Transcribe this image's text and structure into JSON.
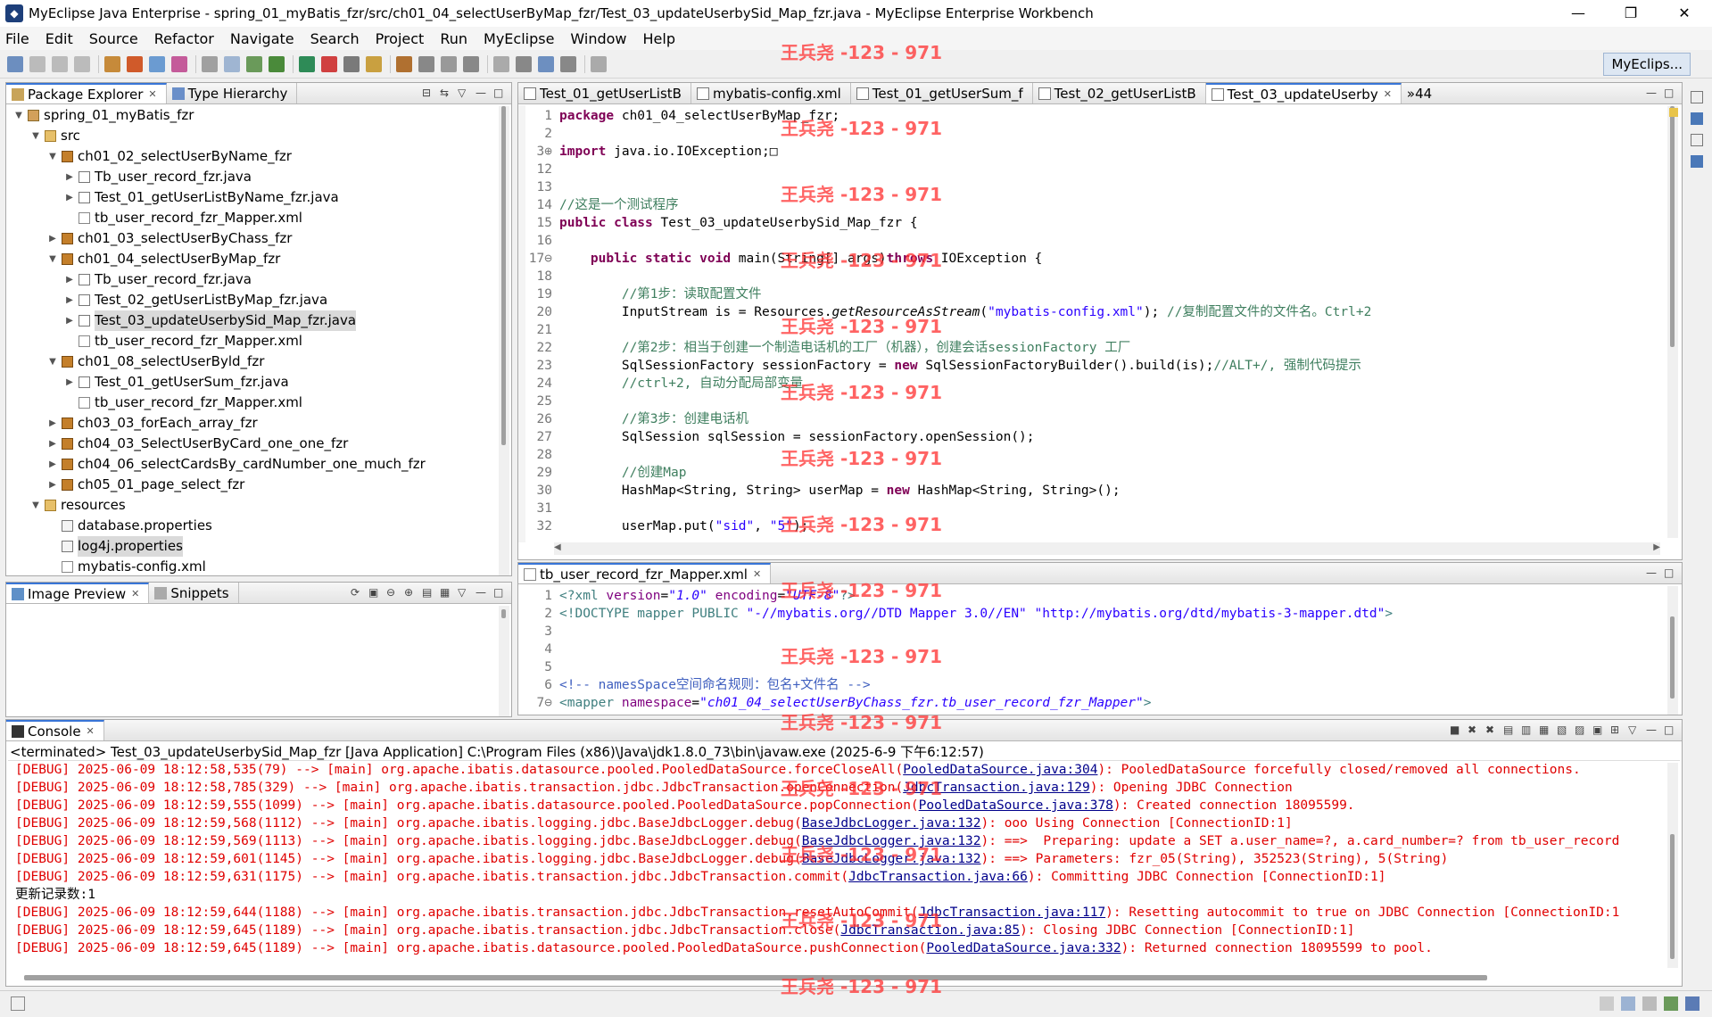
{
  "window": {
    "title": "MyEclipse Java Enterprise - spring_01_myBatis_fzr/src/ch01_04_selectUserByMap_fzr/Test_03_updateUserbySid_Map_fzr.java - MyEclipse Enterprise Workbench",
    "app_icon": "myeclipse-icon",
    "minimize": "—",
    "maximize": "❐",
    "close": "✕"
  },
  "menu": [
    "File",
    "Edit",
    "Source",
    "Refactor",
    "Navigate",
    "Search",
    "Project",
    "Run",
    "MyEclipse",
    "Window",
    "Help"
  ],
  "perspective": "MyEclips...",
  "watermark": "王兵尧 -123 - 971",
  "package_explorer": {
    "tabs": [
      "Package Explorer",
      "Type Hierarchy"
    ],
    "tree": [
      {
        "label": "spring_01_myBatis_fzr",
        "depth": 0,
        "icon": "project",
        "expanded": true
      },
      {
        "label": "src",
        "depth": 1,
        "icon": "src-folder",
        "expanded": true
      },
      {
        "label": "ch01_02_selectUserByName_fzr",
        "depth": 2,
        "icon": "package",
        "expanded": true
      },
      {
        "label": "Tb_user_record_fzr.java",
        "depth": 3,
        "icon": "java",
        "expanded": false
      },
      {
        "label": "Test_01_getUserListByName_fzr.java",
        "depth": 3,
        "icon": "java",
        "expanded": false
      },
      {
        "label": "tb_user_record_fzr_Mapper.xml",
        "depth": 3,
        "icon": "xml"
      },
      {
        "label": "ch01_03_selectUserByChass_fzr",
        "depth": 2,
        "icon": "package",
        "expanded": false
      },
      {
        "label": "ch01_04_selectUserByMap_fzr",
        "depth": 2,
        "icon": "package",
        "expanded": true
      },
      {
        "label": "Tb_user_record_fzr.java",
        "depth": 3,
        "icon": "java",
        "expanded": false
      },
      {
        "label": "Test_02_getUserListByMap_fzr.java",
        "depth": 3,
        "icon": "java",
        "expanded": false
      },
      {
        "label": "Test_03_updateUserbySid_Map_fzr.java",
        "depth": 3,
        "icon": "java",
        "expanded": false,
        "selected": true
      },
      {
        "label": "tb_user_record_fzr_Mapper.xml",
        "depth": 3,
        "icon": "xml"
      },
      {
        "label": "ch01_08_selectUserByld_fzr",
        "depth": 2,
        "icon": "package",
        "expanded": true
      },
      {
        "label": "Test_01_getUserSum_fzr.java",
        "depth": 3,
        "icon": "java",
        "expanded": false
      },
      {
        "label": "tb_user_record_fzr_Mapper.xml",
        "depth": 3,
        "icon": "xml"
      },
      {
        "label": "ch03_03_forEach_array_fzr",
        "depth": 2,
        "icon": "package",
        "expanded": false
      },
      {
        "label": "ch04_03_SelectUserByCard_one_one_fzr",
        "depth": 2,
        "icon": "package",
        "expanded": false
      },
      {
        "label": "ch04_06_selectCardsBy_cardNumber_one_much_fzr",
        "depth": 2,
        "icon": "package",
        "expanded": false
      },
      {
        "label": "ch05_01_page_select_fzr",
        "depth": 2,
        "icon": "package",
        "expanded": false
      },
      {
        "label": "resources",
        "depth": 1,
        "icon": "src-folder",
        "expanded": true
      },
      {
        "label": "database.properties",
        "depth": 2,
        "icon": "properties"
      },
      {
        "label": "log4j.properties",
        "depth": 2,
        "icon": "properties",
        "selected": true
      },
      {
        "label": "mybatis-config.xml",
        "depth": 2,
        "icon": "xml"
      }
    ]
  },
  "image_preview": {
    "tabs": [
      "Image Preview",
      "Snippets"
    ]
  },
  "editor": {
    "tabs": [
      "Test_01_getUserListB",
      "mybatis-config.xml",
      "Test_01_getUserSum_f",
      "Test_02_getUserListB",
      "Test_03_updateUserby"
    ],
    "overflow": "»44",
    "lines": [
      {
        "n": "1",
        "segs": [
          [
            "kw",
            "package"
          ],
          [
            "",
            "ch01_04_selectUserByMap_fzr;"
          ]
        ]
      },
      {
        "n": "2",
        "segs": []
      },
      {
        "n": "3⊕",
        "segs": [
          [
            "kw",
            "import"
          ],
          [
            "",
            "java.io.IOException;□"
          ]
        ]
      },
      {
        "n": "12",
        "segs": []
      },
      {
        "n": "13",
        "segs": []
      },
      {
        "n": "14",
        "segs": [
          [
            "cm",
            "//这是一个测试程序"
          ]
        ]
      },
      {
        "n": "15",
        "segs": [
          [
            "kw",
            "public class"
          ],
          [
            "",
            "Test_03_updateUserbySid_Map_fzr {"
          ]
        ]
      },
      {
        "n": "16",
        "segs": []
      },
      {
        "n": "17⊖",
        "segs": [
          [
            "",
            "    "
          ],
          [
            "kw",
            "public static void"
          ],
          [
            "",
            "main(String[] args)"
          ],
          [
            "kw",
            "throws"
          ],
          [
            "",
            "IOException {"
          ]
        ]
      },
      {
        "n": "18",
        "segs": []
      },
      {
        "n": "19",
        "segs": [
          [
            "",
            "        "
          ],
          [
            "cm",
            "//第1步：读取配置文件"
          ]
        ]
      },
      {
        "n": "20",
        "segs": [
          [
            "",
            "        InputStream is = Resources."
          ],
          [
            "it",
            "getResourceAsStream"
          ],
          [
            "",
            "("
          ],
          [
            "st",
            "\"mybatis-config.xml\""
          ],
          [
            "",
            "); "
          ],
          [
            "cm",
            "//复制配置文件的文件名。Ctrl+2"
          ]
        ]
      },
      {
        "n": "21",
        "segs": []
      },
      {
        "n": "22",
        "segs": [
          [
            "",
            "        "
          ],
          [
            "cm",
            "//第2步：相当于创建一个制造电话机的工厂（机器），创建会话sessionFactory 工厂"
          ]
        ]
      },
      {
        "n": "23",
        "segs": [
          [
            "",
            "        SqlSessionFactory sessionFactory = "
          ],
          [
            "kw",
            "new"
          ],
          [
            "",
            "SqlSessionFactoryBuilder().build(is);"
          ],
          [
            "cm",
            "//ALT+/, 强制代码提示"
          ]
        ]
      },
      {
        "n": "24",
        "segs": [
          [
            "",
            "        "
          ],
          [
            "cm",
            "//ctrl+2, 自动分配局部变量"
          ]
        ]
      },
      {
        "n": "25",
        "segs": []
      },
      {
        "n": "26",
        "segs": [
          [
            "",
            "        "
          ],
          [
            "cm",
            "//第3步：创建电话机"
          ]
        ]
      },
      {
        "n": "27",
        "segs": [
          [
            "",
            "        SqlSession sqlSession = sessionFactory.openSession();"
          ]
        ]
      },
      {
        "n": "28",
        "segs": []
      },
      {
        "n": "29",
        "segs": [
          [
            "",
            "        "
          ],
          [
            "cm",
            "//创建Map"
          ]
        ]
      },
      {
        "n": "30",
        "segs": [
          [
            "",
            "        HashMap<String, String> userMap = "
          ],
          [
            "kw",
            "new"
          ],
          [
            "",
            "HashMap<String, String>();"
          ]
        ]
      },
      {
        "n": "31",
        "segs": []
      },
      {
        "n": "32",
        "segs": [
          [
            "",
            "        userMap.put("
          ],
          [
            "st",
            "\"sid\""
          ],
          [
            "",
            ", "
          ],
          [
            "st",
            "\"5\""
          ],
          [
            "",
            ");"
          ]
        ]
      }
    ]
  },
  "xml_editor": {
    "tab": "tb_user_record_fzr_Mapper.xml",
    "lines": [
      {
        "n": "1",
        "segs": [
          [
            "xtag",
            "<?xml "
          ],
          [
            "xattr",
            "version"
          ],
          [
            "",
            "="
          ],
          [
            "xval",
            "\"1.0\""
          ],
          [
            "xattr",
            " encoding"
          ],
          [
            "",
            "="
          ],
          [
            "xval",
            "\"UTF-8\""
          ],
          [
            "xtag",
            "?>"
          ]
        ]
      },
      {
        "n": "2",
        "segs": [
          [
            "xtag",
            "<!DOCTYPE mapper PUBLIC "
          ],
          [
            "st",
            "\"-//mybatis.org//DTD Mapper 3.0//EN\""
          ],
          [
            "",
            " "
          ],
          [
            "st",
            "\"http://mybatis.org/dtd/mybatis-3-mapper.dtd\""
          ],
          [
            "xtag",
            ">"
          ]
        ]
      },
      {
        "n": "3",
        "segs": []
      },
      {
        "n": "4",
        "segs": []
      },
      {
        "n": "5",
        "segs": []
      },
      {
        "n": "6",
        "segs": [
          [
            "xcm",
            "<!-- namesSpace空间命名规则：包名+文件名 -->"
          ]
        ]
      },
      {
        "n": "7⊖",
        "segs": [
          [
            "xtag",
            "<mapper "
          ],
          [
            "xattr",
            "namespace"
          ],
          [
            "",
            "="
          ],
          [
            "xval",
            "\"ch01_04_selectUserByChass_fzr.tb_user_record_fzr_Mapper\""
          ],
          [
            "xtag",
            ">"
          ]
        ]
      }
    ]
  },
  "console": {
    "tab": "Console",
    "header": "<terminated> Test_03_updateUserbySid_Map_fzr [Java Application] C:\\Program Files (x86)\\Java\\jdk1.8.0_73\\bin\\javaw.exe (2025-6-9 下午6:12:57)",
    "lines": [
      {
        "type": "debug",
        "pre": "[DEBUG] 2025-06-09 18:12:58,535(79) --> [main] org.apache.ibatis.datasource.pooled.PooledDataSource.forceCloseAll(",
        "link": "PooledDataSource.java:304",
        "post": "): PooledDataSource forcefully closed/removed all connections."
      },
      {
        "type": "debug",
        "pre": "[DEBUG] 2025-06-09 18:12:58,785(329) --> [main] org.apache.ibatis.transaction.jdbc.JdbcTransaction.openConnection(",
        "link": "JdbcTransaction.java:129",
        "post": "): Opening JDBC Connection"
      },
      {
        "type": "debug",
        "pre": "[DEBUG] 2025-06-09 18:12:59,555(1099) --> [main] org.apache.ibatis.datasource.pooled.PooledDataSource.popConnection(",
        "link": "PooledDataSource.java:378",
        "post": "): Created connection 18095599."
      },
      {
        "type": "debug",
        "pre": "[DEBUG] 2025-06-09 18:12:59,568(1112) --> [main] org.apache.ibatis.logging.jdbc.BaseJdbcLogger.debug(",
        "link": "BaseJdbcLogger.java:132",
        "post": "): ooo Using Connection [ConnectionID:1]"
      },
      {
        "type": "debug",
        "pre": "[DEBUG] 2025-06-09 18:12:59,569(1113) --> [main] org.apache.ibatis.logging.jdbc.BaseJdbcLogger.debug(",
        "link": "BaseJdbcLogger.java:132",
        "post": "): ==>  Preparing: update a SET a.user_name=?, a.card_number=? from tb_user_record"
      },
      {
        "type": "debug",
        "pre": "[DEBUG] 2025-06-09 18:12:59,601(1145) --> [main] org.apache.ibatis.logging.jdbc.BaseJdbcLogger.debug(",
        "link": "BaseJdbcLogger.java:132",
        "post": "): ==> Parameters: fzr_05(String), 352523(String), 5(String)"
      },
      {
        "type": "debug",
        "pre": "[DEBUG] 2025-06-09 18:12:59,631(1175) --> [main] org.apache.ibatis.transaction.jdbc.JdbcTransaction.commit(",
        "link": "JdbcTransaction.java:66",
        "post": "): Committing JDBC Connection [ConnectionID:1]"
      },
      {
        "type": "plain",
        "pre": "更新记录数:1",
        "link": "",
        "post": ""
      },
      {
        "type": "debug",
        "pre": "[DEBUG] 2025-06-09 18:12:59,644(1188) --> [main] org.apache.ibatis.transaction.jdbc.JdbcTransaction.resetAutoCommit(",
        "link": "JdbcTransaction.java:117",
        "post": "): Resetting autocommit to true on JDBC Connection [ConnectionID:1"
      },
      {
        "type": "debug",
        "pre": "[DEBUG] 2025-06-09 18:12:59,645(1189) --> [main] org.apache.ibatis.transaction.jdbc.JdbcTransaction.close(",
        "link": "JdbcTransaction.java:85",
        "post": "): Closing JDBC Connection [ConnectionID:1]"
      },
      {
        "type": "debug",
        "pre": "[DEBUG] 2025-06-09 18:12:59,645(1189) --> [main] org.apache.ibatis.datasource.pooled.PooledDataSource.pushConnection(",
        "link": "PooledDataSource.java:332",
        "post": "): Returned connection 18095599 to pool."
      }
    ]
  }
}
